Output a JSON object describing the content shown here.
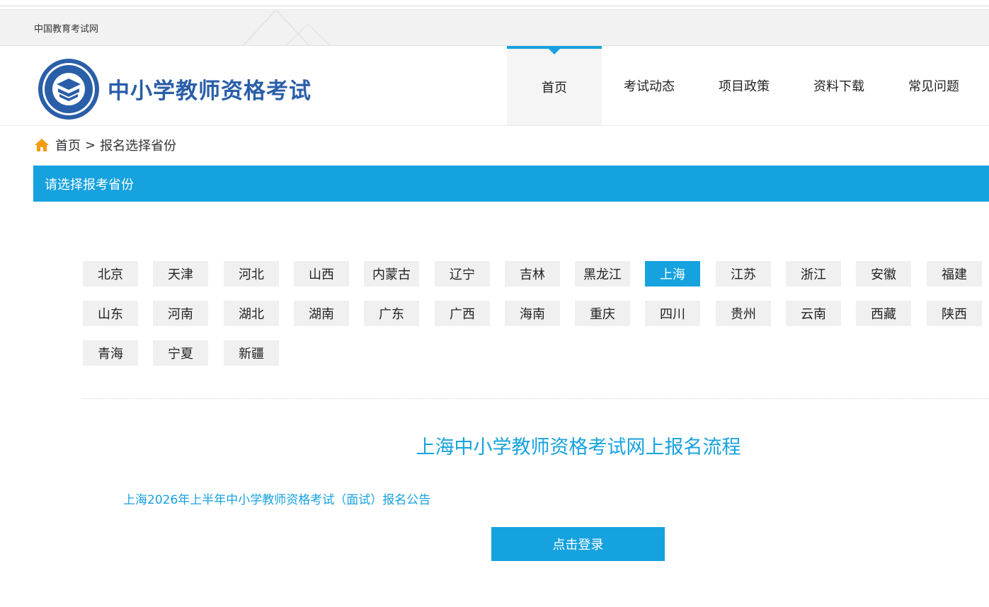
{
  "topbar": {
    "site_name": "中国教育考试网"
  },
  "header": {
    "title": "中小学教师资格考试"
  },
  "nav": {
    "items": [
      {
        "label": "首页",
        "active": true
      },
      {
        "label": "考试动态"
      },
      {
        "label": "项目政策"
      },
      {
        "label": "资料下载"
      },
      {
        "label": "常见问题"
      }
    ]
  },
  "breadcrumb": {
    "home": "首页",
    "separator": ">",
    "current": "报名选择省份"
  },
  "section": {
    "title": "请选择报考省份"
  },
  "provinces": [
    "北京",
    "天津",
    "河北",
    "山西",
    "内蒙古",
    "辽宁",
    "吉林",
    "黑龙江",
    "上海",
    "江苏",
    "浙江",
    "安徽",
    "福建",
    "山东",
    "河南",
    "湖北",
    "湖南",
    "广东",
    "广西",
    "海南",
    "重庆",
    "四川",
    "贵州",
    "云南",
    "西藏",
    "陕西",
    "青海",
    "宁夏",
    "新疆"
  ],
  "selected_province": "上海",
  "flow": {
    "title": "上海中小学教师资格考试网上报名流程",
    "notice": "上海2026年上半年中小学教师资格考试（面试）报名公告",
    "login_label": "点击登录"
  },
  "colors": {
    "accent": "#16a2de",
    "logo_blue": "#2a5ea8",
    "home_icon": "#f39c12"
  }
}
